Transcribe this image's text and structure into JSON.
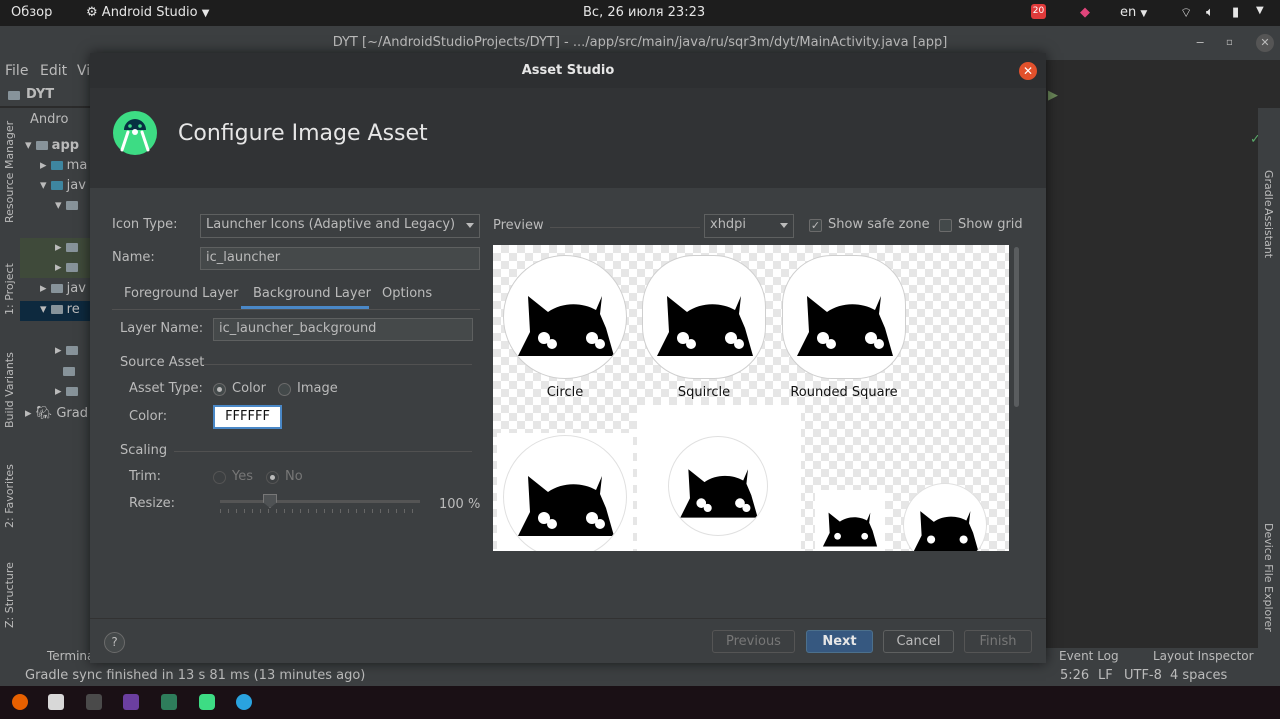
{
  "topbar": {
    "activities": "Обзор",
    "app": "Android Studio",
    "clock": "Вс, 26 июля  23:23",
    "notifications": "20",
    "language": "en"
  },
  "ide": {
    "window_title": "DYT [~/AndroidStudioProjects/DYT] - .../app/src/main/java/ru/sqr3m/dyt/MainActivity.java [app]",
    "menu": [
      "File",
      "Edit",
      "Vi"
    ],
    "breadcrumb": "DYT",
    "project_view": "Andro",
    "tree": [
      "app",
      "ma",
      "jav",
      "jav",
      "re",
      "Grad"
    ],
    "left_tools": [
      "Resource Manager",
      "1: Project",
      "Build Variants",
      "2: Favorites",
      "Z: Structure"
    ],
    "right_tools": [
      "Gradle",
      "Assistant",
      "Device File Explorer"
    ],
    "bottom_left": "Termina",
    "bottom_right": [
      "Event Log",
      "Layout Inspector"
    ],
    "status_message": "Gradle sync finished in 13 s 81 ms (13 minutes ago)",
    "status_right": [
      "5:26",
      "LF",
      "UTF-8",
      "4 spaces"
    ]
  },
  "dialog": {
    "title": "Asset Studio",
    "heading": "Configure Image Asset",
    "icon_type_label": "Icon Type:",
    "icon_type_value": "Launcher Icons (Adaptive and Legacy)",
    "name_label": "Name:",
    "name_value": "ic_launcher",
    "tabs": [
      "Foreground Layer",
      "Background Layer",
      "Options"
    ],
    "layer_name_label": "Layer Name:",
    "layer_name_value": "ic_launcher_background",
    "source_asset_label": "Source Asset",
    "asset_type_label": "Asset Type:",
    "asset_type_color": "Color",
    "asset_type_image": "Image",
    "color_label": "Color:",
    "color_value": "FFFFFF",
    "scaling_label": "Scaling",
    "trim_label": "Trim:",
    "trim_yes": "Yes",
    "trim_no": "No",
    "resize_label": "Resize:",
    "resize_value": "100 %",
    "resize_level": 0.25,
    "preview_label": "Preview",
    "density_value": "xhdpi",
    "show_safe_zone": "Show safe zone",
    "show_grid": "Show grid",
    "preview_shapes": [
      "Circle",
      "Squircle",
      "Rounded Square"
    ],
    "buttons": {
      "help": "?",
      "previous": "Previous",
      "next": "Next",
      "cancel": "Cancel",
      "finish": "Finish"
    }
  }
}
